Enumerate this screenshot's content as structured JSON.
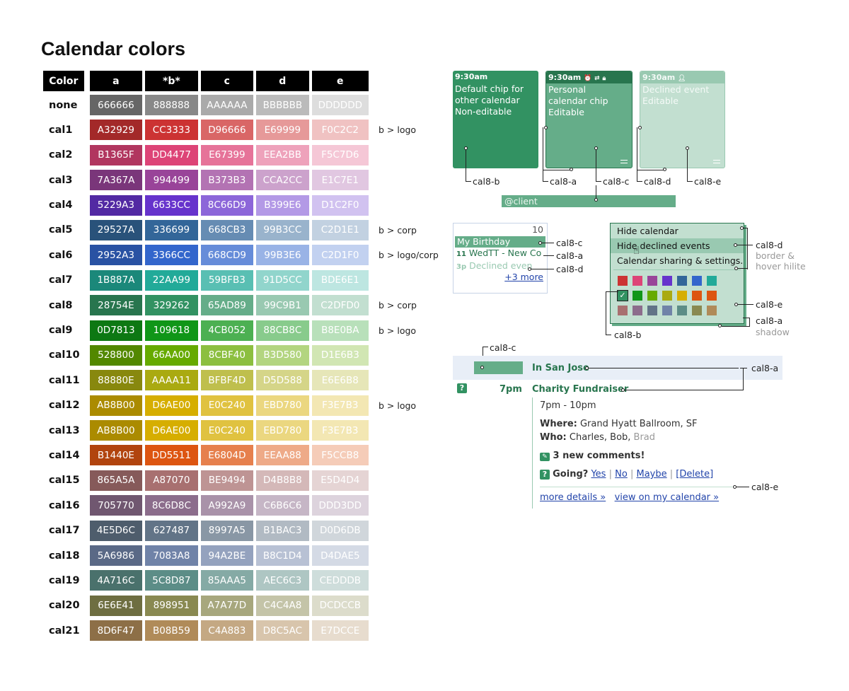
{
  "title": "Calendar colors",
  "table": {
    "headers": [
      "Color",
      "a",
      "*b*",
      "c",
      "d",
      "e"
    ],
    "rows": [
      {
        "name": "none",
        "a": "666666",
        "b": "888888",
        "c": "AAAAAA",
        "d": "BBBBBB",
        "e": "DDDDDD",
        "note": ""
      },
      {
        "name": "cal1",
        "a": "A32929",
        "b": "CC3333",
        "c": "D96666",
        "d": "E69999",
        "e": "F0C2C2",
        "note": "b > logo"
      },
      {
        "name": "cal2",
        "a": "B1365F",
        "b": "DD4477",
        "c": "E67399",
        "d": "EEA2BB",
        "e": "F5C7D6",
        "note": ""
      },
      {
        "name": "cal3",
        "a": "7A367A",
        "b": "994499",
        "c": "B373B3",
        "d": "CCA2CC",
        "e": "E1C7E1",
        "note": ""
      },
      {
        "name": "cal4",
        "a": "5229A3",
        "b": "6633CC",
        "c": "8C66D9",
        "d": "B399E6",
        "e": "D1C2F0",
        "note": ""
      },
      {
        "name": "cal5",
        "a": "29527A",
        "b": "336699",
        "c": "668CB3",
        "d": "99B3CC",
        "e": "C2D1E1",
        "note": "b > corp"
      },
      {
        "name": "cal6",
        "a": "2952A3",
        "b": "3366CC",
        "c": "668CD9",
        "d": "99B3E6",
        "e": "C2D1F0",
        "note": "b > logo/corp"
      },
      {
        "name": "cal7",
        "a": "1B887A",
        "b": "22AA99",
        "c": "59BFB3",
        "d": "91D5CC",
        "e": "BDE6E1",
        "note": ""
      },
      {
        "name": "cal8",
        "a": "28754E",
        "b": "329262",
        "c": "65AD89",
        "d": "99C9B1",
        "e": "C2DFD0",
        "note": "b > corp"
      },
      {
        "name": "cal9",
        "a": "0D7813",
        "b": "109618",
        "c": "4CB052",
        "d": "88CB8C",
        "e": "B8E0BA",
        "note": "b > logo"
      },
      {
        "name": "cal10",
        "a": "528800",
        "b": "66AA00",
        "c": "8CBF40",
        "d": "B3D580",
        "e": "D1E6B3",
        "note": ""
      },
      {
        "name": "cal11",
        "a": "88880E",
        "b": "AAAA11",
        "c": "BFBF4D",
        "d": "D5D588",
        "e": "E6E6B8",
        "note": ""
      },
      {
        "name": "cal12",
        "a": "AB8B00",
        "b": "D6AE00",
        "c": "E0C240",
        "d": "EBD780",
        "e": "F3E7B3",
        "note": "b > logo"
      },
      {
        "name": "cal13",
        "a": "AB8B00",
        "b": "D6AE00",
        "c": "E0C240",
        "d": "EBD780",
        "e": "F3E7B3",
        "note": ""
      },
      {
        "name": "cal14",
        "a": "B1440E",
        "b": "DD5511",
        "c": "E6804D",
        "d": "EEAA88",
        "e": "F5CCB8",
        "note": ""
      },
      {
        "name": "cal15",
        "a": "865A5A",
        "b": "A87070",
        "c": "BE9494",
        "d": "D4B8B8",
        "e": "E5D4D4",
        "note": ""
      },
      {
        "name": "cal16",
        "a": "705770",
        "b": "8C6D8C",
        "c": "A992A9",
        "d": "C6B6C6",
        "e": "DDD3DD",
        "note": ""
      },
      {
        "name": "cal17",
        "a": "4E5D6C",
        "b": "627487",
        "c": "8997A5",
        "d": "B1BAC3",
        "e": "D0D6DB",
        "note": ""
      },
      {
        "name": "cal18",
        "a": "5A6986",
        "b": "7083A8",
        "c": "94A2BE",
        "d": "B8C1D4",
        "e": "D4DAE5",
        "note": ""
      },
      {
        "name": "cal19",
        "a": "4A716C",
        "b": "5C8D87",
        "c": "85AAA5",
        "d": "AEC6C3",
        "e": "CEDDDB",
        "note": ""
      },
      {
        "name": "cal20",
        "a": "6E6E41",
        "b": "898951",
        "c": "A7A77D",
        "d": "C4C4A8",
        "e": "DCDCCB",
        "note": ""
      },
      {
        "name": "cal21",
        "a": "8D6F47",
        "b": "B08B59",
        "c": "C4A883",
        "d": "D8C5AC",
        "e": "E7DCCE",
        "note": ""
      }
    ]
  },
  "chips": {
    "chip1": {
      "time": "9:30am",
      "lines": [
        "Default chip for",
        "other calendar",
        "Non-editable"
      ]
    },
    "chip2": {
      "time": "9:30am",
      "lines": [
        "Personal",
        "calendar chip",
        "Editable"
      ]
    },
    "chip3": {
      "time": "9:30am",
      "lines": [
        "Declined event",
        "Editable"
      ]
    }
  },
  "labels": {
    "cal8_b": "cal8-b",
    "cal8_a": "cal8-a",
    "cal8_c": "cal8-c",
    "cal8_d": "cal8-d",
    "cal8_e": "cal8-e",
    "client": "@client",
    "border_hover": "border &",
    "border_hover2": "hover hilite",
    "shadow": "shadow"
  },
  "month_cell": {
    "day": "10",
    "event1": "My Birthday",
    "event2_time": "11",
    "event2": "WedTT - New Co",
    "event3_time": "3p",
    "event3": "Declined even",
    "more": "+3 more"
  },
  "menu": {
    "items": [
      "Hide calendar",
      "Hide declined events",
      "Calendar sharing & settings..."
    ]
  },
  "palette": {
    "row1": [
      "#CC3333",
      "#DD4477",
      "#994499",
      "#6633CC",
      "#336699",
      "#3366CC",
      "#22AA99"
    ],
    "row2": [
      "#329262",
      "#109618",
      "#66AA00",
      "#AAAA11",
      "#D6AE00",
      "#DD5511",
      "#DD5511"
    ],
    "row3": [
      "#A87070",
      "#8C6D8C",
      "#627487",
      "#7083A8",
      "#5C8D87",
      "#898951",
      "#B08B59"
    ]
  },
  "agenda": {
    "allday": "In San Jose",
    "time": "7pm",
    "event": "Charity Fundraiser",
    "timerange": "7pm - 10pm",
    "where_label": "Where:",
    "where": "Grand Hyatt Ballroom, SF",
    "who_label": "Who:",
    "who": "Charles, Bob,",
    "who_declined": "Brad",
    "comments": "3 new comments!",
    "going": "Going?",
    "yes": "Yes",
    "no": "No",
    "maybe": "Maybe",
    "delete": "[Delete]",
    "more_details": "more details »",
    "view_cal": "view on my calendar »"
  }
}
